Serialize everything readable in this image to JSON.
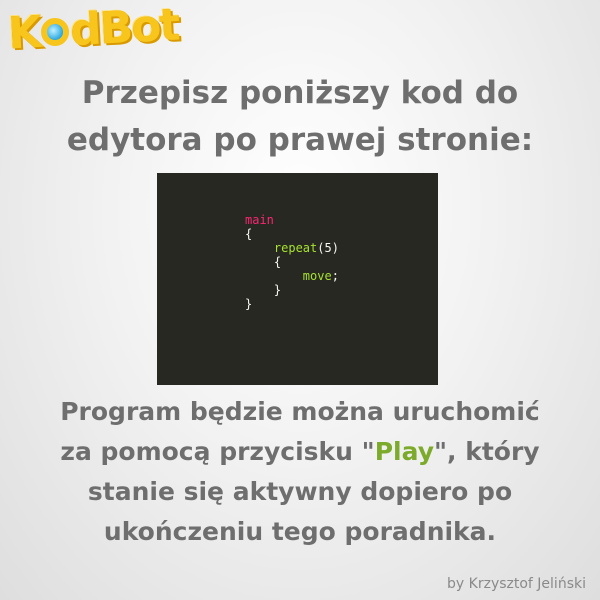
{
  "logo": {
    "before": "K",
    "after": "dBot"
  },
  "heading": {
    "line1": "Przepisz poniższy kod do",
    "line2": "edytora po prawej stronie:"
  },
  "code": {
    "main": "main",
    "open1": "{",
    "repeat": "repeat",
    "paren_open": "(",
    "count": "5",
    "paren_close": ")",
    "open2": "{",
    "move": "move",
    "semicolon": ";",
    "close2": "}",
    "close1": "}"
  },
  "description": {
    "line1": "Program będzie można uruchomić",
    "line2_before": "za pomocą przycisku \"",
    "play": "Play",
    "line2_after": "\", który",
    "line3": "stanie się aktywny dopiero po",
    "line4": "ukończeniu tego poradnika."
  },
  "author": "by Krzysztof Jeliński",
  "colors": {
    "keyword": "#f92672",
    "function": "#a6e22e",
    "play": "#7caa2a",
    "editor_bg": "#272822"
  }
}
